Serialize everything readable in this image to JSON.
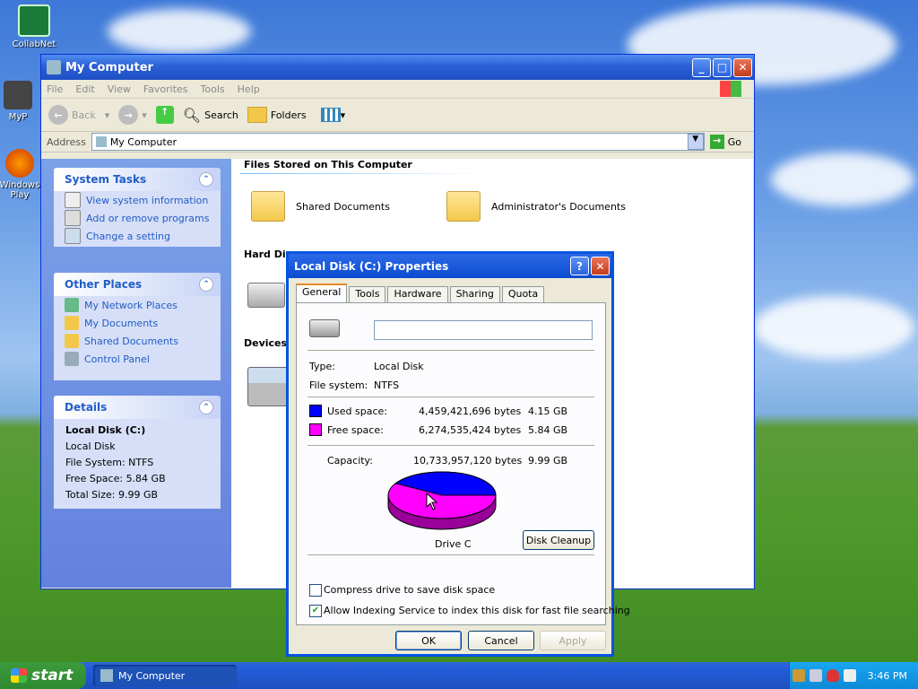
{
  "desktop": {
    "icons": [
      {
        "label": "CollabNet"
      },
      {
        "label": "MyP"
      },
      {
        "label": "Windows Play"
      }
    ]
  },
  "explorer": {
    "title": "My Computer",
    "menu": [
      "File",
      "Edit",
      "View",
      "Favorites",
      "Tools",
      "Help"
    ],
    "toolbar": {
      "back": "Back",
      "search": "Search",
      "folders": "Folders"
    },
    "address": {
      "label": "Address",
      "value": "My Computer",
      "go": "Go"
    },
    "system_tasks": {
      "title": "System Tasks",
      "items": [
        "View system information",
        "Add or remove programs",
        "Change a setting"
      ]
    },
    "other_places": {
      "title": "Other Places",
      "items": [
        "My Network Places",
        "My Documents",
        "Shared Documents",
        "Control Panel"
      ]
    },
    "details": {
      "title": "Details",
      "name": "Local Disk (C:)",
      "type": "Local Disk",
      "fs": "File System: NTFS",
      "free": "Free Space: 5.84 GB",
      "total": "Total Size: 9.99 GB"
    },
    "groups": {
      "files": "Files Stored on This Computer",
      "hard": "Hard Disk",
      "devices": "Devices"
    },
    "folders": [
      "Shared Documents",
      "Administrator's Documents"
    ]
  },
  "dialog": {
    "title": "Local Disk (C:) Properties",
    "tabs": [
      "General",
      "Tools",
      "Hardware",
      "Sharing",
      "Quota"
    ],
    "name_value": "",
    "type_label": "Type:",
    "type_value": "Local Disk",
    "fs_label": "File system:",
    "fs_value": "NTFS",
    "used": {
      "label": "Used space:",
      "bytes": "4,459,421,696 bytes",
      "gb": "4.15 GB",
      "color": "#0000ff"
    },
    "free": {
      "label": "Free space:",
      "bytes": "6,274,535,424 bytes",
      "gb": "5.84 GB",
      "color": "#ff00ff"
    },
    "capacity": {
      "label": "Capacity:",
      "bytes": "10,733,957,120 bytes",
      "gb": "9.99 GB"
    },
    "used_fraction": 0.4155,
    "drive_label": "Drive C",
    "cleanup": "Disk Cleanup",
    "compress": "Compress drive to save disk space",
    "indexing": "Allow Indexing Service to index this disk for fast file searching",
    "ok": "OK",
    "cancel": "Cancel",
    "apply": "Apply"
  },
  "taskbar": {
    "start": "start",
    "task": "My Computer",
    "clock": "3:46 PM"
  }
}
